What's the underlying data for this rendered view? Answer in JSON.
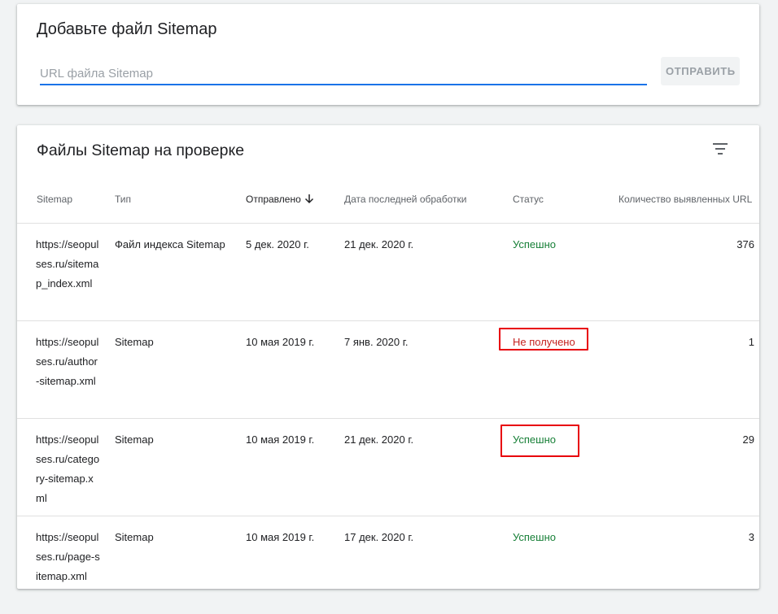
{
  "add_sitemap": {
    "title": "Добавьте файл Sitemap",
    "placeholder": "URL файла Sitemap",
    "submit_label": "ОТПРАВИТЬ"
  },
  "list": {
    "title": "Файлы Sitemap на проверке",
    "filter_icon": "filter-icon",
    "columns": {
      "sitemap": "Sitemap",
      "type": "Тип",
      "sent": "Отправлено",
      "last_processed": "Дата последней обработки",
      "status": "Статус",
      "url_count": "Количество выявленных URL"
    },
    "sort_icon": "arrow-down-icon",
    "rows": [
      {
        "url": "https://seopulses.ru/sitemap_index.xml",
        "type": "Файл индекса Sitemap",
        "sent": "5 дек. 2020 г.",
        "last": "21 дек. 2020 г.",
        "status": "Успешно",
        "count": "376"
      },
      {
        "url": "https://seopulses.ru/author-sitemap.xml",
        "type": "Sitemap",
        "sent": "10 мая 2019 г.",
        "last": "7 янв. 2020 г.",
        "status": "Не получено",
        "count": "1"
      },
      {
        "url": "https://seopulses.ru/category-sitemap.xml",
        "type": "Sitemap",
        "sent": "10 мая 2019 г.",
        "last": "21 дек. 2020 г.",
        "status": "Успешно",
        "count": "29"
      },
      {
        "url": "https://seopulses.ru/page-sitemap.xml",
        "type": "Sitemap",
        "sent": "10 мая 2019 г.",
        "last": "17 дек. 2020 г.",
        "status": "Успешно",
        "count": "3"
      }
    ]
  },
  "colors": {
    "accent": "#1a73e8",
    "success": "#188038",
    "error": "#c5221f",
    "highlight": "#e8000b"
  }
}
